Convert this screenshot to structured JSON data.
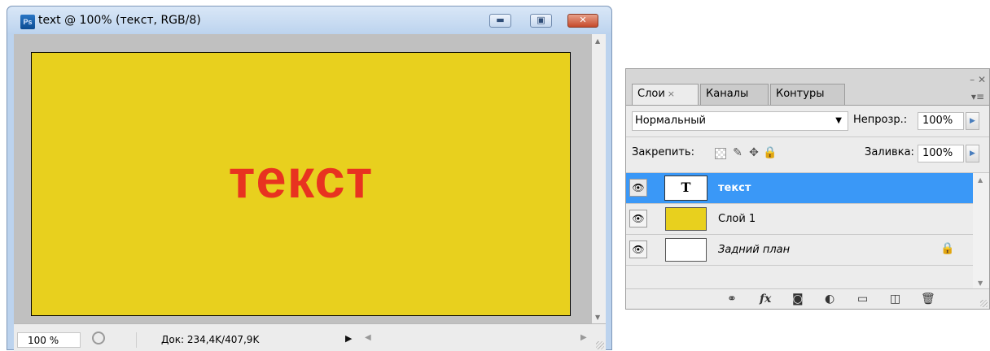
{
  "document_window": {
    "title": "text @ 100% (текст, RGB/8)",
    "ps_icon": "Ps",
    "buttons": {
      "minimize": "▬",
      "maximize": "▣",
      "close": "✕"
    },
    "canvas": {
      "background_color": "#e8d01e",
      "text": "текст",
      "text_color": "#e83320"
    },
    "status": {
      "zoom": "100 %",
      "doc_size": "Док: 234,4K/407,9K"
    }
  },
  "layers_panel": {
    "tabs": [
      {
        "label": "Слои",
        "active": true,
        "close": "×"
      },
      {
        "label": "Каналы",
        "active": false
      },
      {
        "label": "Контуры",
        "active": false
      }
    ],
    "blend_mode": "Нормальный",
    "opacity_label": "Непрозр.:",
    "opacity_value": "100%",
    "lock_label": "Закрепить:",
    "fill_label": "Заливка:",
    "fill_value": "100%",
    "layers": [
      {
        "name": "текст",
        "thumb": "T",
        "selected": true,
        "icon": "eye-icon"
      },
      {
        "name": "Слой 1",
        "selected": false,
        "thumb_color": "#e8d01e",
        "icon": "eye-icon"
      },
      {
        "name": "Задний план",
        "selected": false,
        "locked": true,
        "icon": "eye-icon"
      }
    ],
    "bottom_icons": [
      "link-icon",
      "fx-icon",
      "mask-icon",
      "adjustment-icon",
      "folder-icon",
      "new-layer-icon",
      "trash-icon"
    ],
    "fx_label": "fx"
  }
}
